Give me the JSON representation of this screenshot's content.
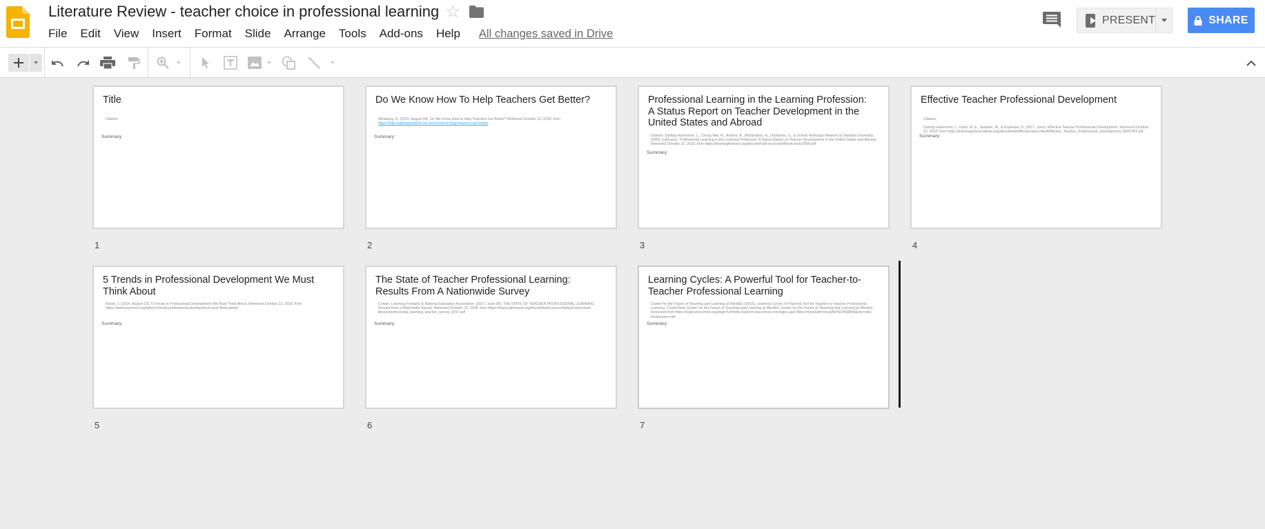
{
  "app": {
    "title": "Literature Review - teacher choice in professional learning",
    "save_status": "All changes saved in Drive"
  },
  "menu": [
    "File",
    "Edit",
    "View",
    "Insert",
    "Format",
    "Slide",
    "Arrange",
    "Tools",
    "Add-ons",
    "Help"
  ],
  "actions": {
    "present_label": "PRESENT",
    "share_label": "SHARE"
  },
  "colors": {
    "share_blue": "#4a8af4",
    "slides_yellow": "#f4b400",
    "link_blue": "#46a4e0"
  },
  "slides": [
    {
      "number": "1",
      "title": "Title",
      "citation": "Citation",
      "citation_link": "",
      "summary": "Summary:"
    },
    {
      "number": "2",
      "title": "Do We Know How To Help Teachers Get Better?",
      "citation": "Weisberg, D. (2015, August 04). Do We Know How to Help Teachers Get Better? Retrieved October 22, 2018, from",
      "citation_link": "https://tntp.org/blog/post/do-we-know-how-to-help-teachers-get-better",
      "summary": "Summary:"
    },
    {
      "number": "3",
      "title": "Professional Learning in the Learning Profession: A Status Report on Teacher Development in the United States and Abroad",
      "citation": "Citation: Darling-Hammond, L., Chung Wei, R., Andree, A., Richardson, N., Orphanos, S., & School Redesign Network at Stanford University. (2009, February). Professional Learning in the Learning Profession: A Status Report on Teacher Development in the United States and Abroad. Retrieved October 22, 2018, from https://learningforward.org/docs/default-source/pdf/nsdcstudy2009.pdf",
      "citation_link": "",
      "summary": "Summary:"
    },
    {
      "number": "4",
      "title": "Effective Teacher Professional Development",
      "citation": "Citation:",
      "citation_link": "",
      "citation_2": "Darling-Hammond, L., Hyler, M. E., Gardner, M., & Espinoza, D. (2017, June). Effective Teacher Professional Development. Retrieved October 22, 2018, from https://learningpolicyinstitute.org/sites/default/files/product-files/Effective_Teacher_Professional_Development_REPORT.pdf",
      "summary": "Summary:"
    },
    {
      "number": "5",
      "title": "5 Trends in Professional Development We Must Think About",
      "citation": "Kissin, J. (2014, August 23). 5 Trends in Professional Development We Must Think About. Retrieved October 22, 2018, from https://www.teachers.org/daily/5-trends-professional-development-must-think-about/",
      "citation_link": "",
      "summary": "Summary:"
    },
    {
      "number": "6",
      "title": "The State of Teacher Professional Learning: Results From A Nationwide Survey",
      "citation": "Corwin, Learning Forward, & National Education Association. (2017, June 28). THE STATE OF TEACHER PROFESSIONAL LEARNING Results from a Nationwide Survey. Retrieved October 22, 2018, from https://learningforward.org/docs/default-source/default-document-library/professional_learning_teacher_survey_2017.pdf",
      "citation_link": "",
      "summary": "Summary:"
    },
    {
      "number": "7",
      "title": "Learning Cycles: A Powerful Tool for Teacher-to-Teacher Professional Learning",
      "citation": "Center for the Future of Teaching and Learning at WestEd. (2016). Learning Cycles: A Powerful Tool for Teacher-to-Teacher Professional Learning. CenterView. Center for the Future of Teaching and Learning at WestEd. Center for the Future of Teaching and Learning at WestEd. Retrieved from https://login.ebscohost.org/login?url=http://search.ebscohost.com/login.aspx?direct=true&db=eric&AN=ED568994&site=eds-live&scope=site",
      "citation_link": "",
      "summary": "Summary:"
    }
  ]
}
